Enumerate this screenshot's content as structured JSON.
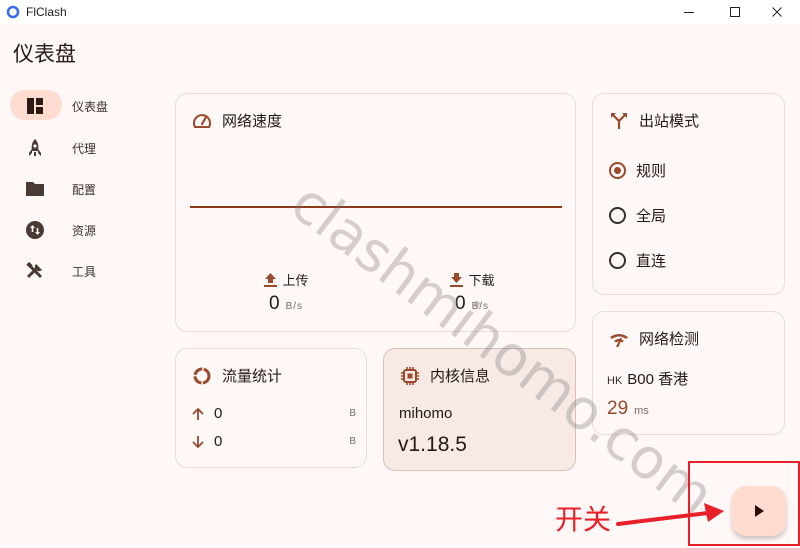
{
  "window": {
    "title": "FlClash",
    "controls": [
      "minimize",
      "maximize",
      "close"
    ]
  },
  "page": {
    "title": "仪表盘"
  },
  "sidebar": {
    "items": [
      {
        "label": "仪表盘",
        "icon": "dashboard-icon",
        "active": true
      },
      {
        "label": "代理",
        "icon": "rocket-icon",
        "active": false
      },
      {
        "label": "配置",
        "icon": "folder-icon",
        "active": false
      },
      {
        "label": "资源",
        "icon": "swap-vert-circle-icon",
        "active": false
      },
      {
        "label": "工具",
        "icon": "tools-icon",
        "active": false
      }
    ]
  },
  "network_speed": {
    "title": "网络速度",
    "icon": "speedometer-icon",
    "upload": {
      "label": "上传",
      "value": "0",
      "unit": "B/s"
    },
    "download": {
      "label": "下载",
      "value": "0",
      "unit": "B/s"
    }
  },
  "outbound_mode": {
    "title": "出站模式",
    "icon": "call-split-icon",
    "options": [
      {
        "label": "规则",
        "checked": true
      },
      {
        "label": "全局",
        "checked": false
      },
      {
        "label": "直连",
        "checked": false
      }
    ]
  },
  "traffic_stats": {
    "title": "流量统计",
    "icon": "donut-icon",
    "upload": {
      "value": "0",
      "unit": "B"
    },
    "download": {
      "value": "0",
      "unit": "B"
    }
  },
  "core_info": {
    "title": "内核信息",
    "icon": "chip-icon",
    "name": "mihomo",
    "version": "v1.18.5"
  },
  "network_check": {
    "title": "网络检测",
    "icon": "wifi-icon",
    "country_code": "HK",
    "node_name": "B00 香港",
    "delay": "29",
    "delay_unit": "ms"
  },
  "fab": {
    "icon": "play-icon",
    "state": "stopped"
  },
  "annotation": {
    "label": "开关",
    "color": "#e8202a"
  },
  "watermark": {
    "text": "clashmihomo.com"
  },
  "colors": {
    "primary": "#9a4a2c",
    "background": "#fff8f6",
    "nav_active": "#ffdbd0",
    "card_border": "#e9ddd9",
    "tonal_card": "#f7e9e4"
  }
}
